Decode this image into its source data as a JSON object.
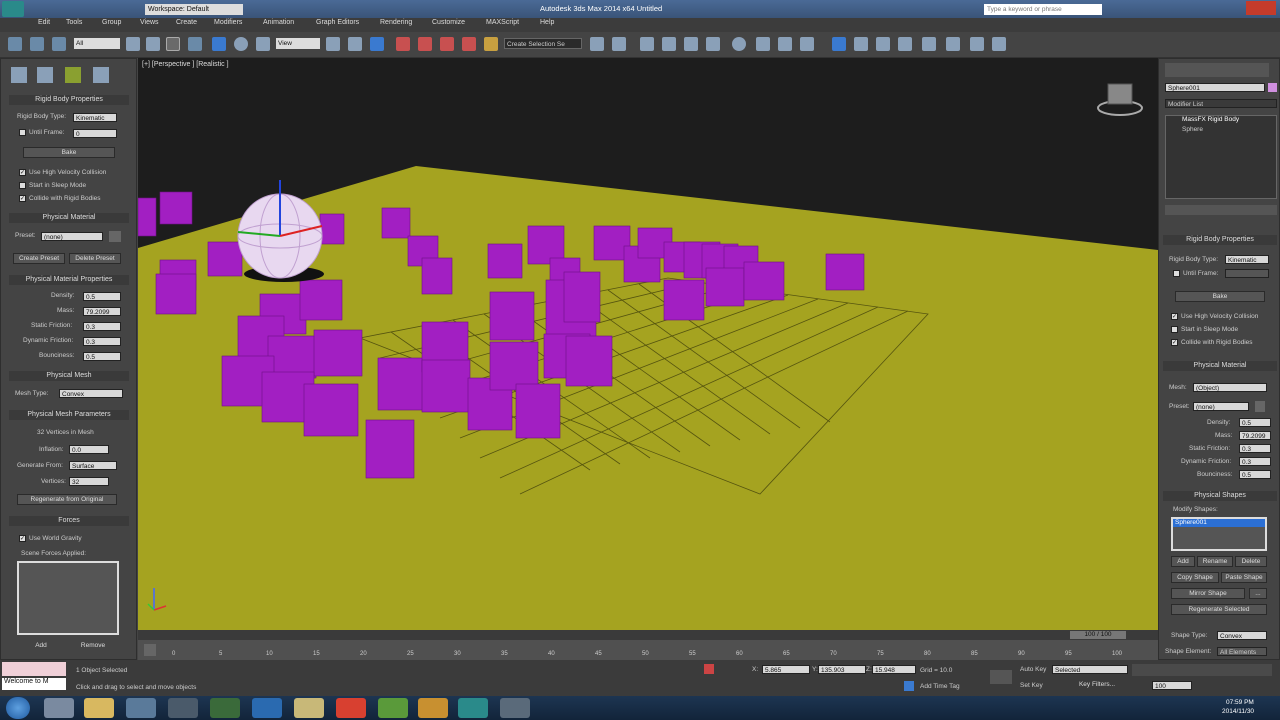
{
  "app": {
    "title": "Autodesk 3ds Max 2014 x64  Untitled",
    "workspace": "Workspace: Default",
    "search_placeholder": "Type a keyword or phrase"
  },
  "menu": [
    "Edit",
    "Tools",
    "Group",
    "Views",
    "Create",
    "Modifiers",
    "Animation",
    "Graph Editors",
    "Rendering",
    "Customize",
    "MAXScript",
    "Help"
  ],
  "toolbar": {
    "selection_filter": "All",
    "ref_coord": "View",
    "named_selection": "Create Selection Se"
  },
  "viewport": {
    "label": "[+] [Perspective ] [Realistic ]",
    "bg": "#1d1d1d",
    "ground": "#a5a320",
    "box_color": "#a21fc2"
  },
  "left_panel": {
    "rigid_body": {
      "title": "Rigid Body Properties",
      "type_label": "Rigid Body Type:",
      "type_value": "Kinematic",
      "until_frame_label": "Until Frame:",
      "until_frame_value": "0",
      "bake": "Bake",
      "high_velocity": "Use High Velocity Collision",
      "sleep": "Start in Sleep Mode",
      "collide": "Collide with Rigid Bodies"
    },
    "physical_material": {
      "title": "Physical Material",
      "preset_label": "Preset:",
      "preset_value": "(none)",
      "create": "Create Preset",
      "delete": "Delete Preset"
    },
    "pm_props": {
      "title": "Physical Material Properties",
      "density_label": "Density:",
      "density": "0.5",
      "mass_label": "Mass:",
      "mass": "79.2099",
      "static_label": "Static Friction:",
      "static": "0.3",
      "dynamic_label": "Dynamic Friction:",
      "dynamic": "0.3",
      "bounce_label": "Bounciness:",
      "bounce": "0.5"
    },
    "physical_mesh": {
      "title": "Physical Mesh",
      "type_label": "Mesh Type:",
      "type_value": "Convex"
    },
    "pm_params": {
      "title": "Physical Mesh Parameters",
      "verts_in_mesh": "32 Vertices in Mesh",
      "inflation_label": "Inflation:",
      "inflation": "0.0",
      "gen_label": "Generate From:",
      "gen": "Surface",
      "vertices_label": "Vertices:",
      "vertices": "32",
      "regen": "Regenerate from Original"
    },
    "forces": {
      "title": "Forces",
      "gravity": "Use World Gravity",
      "applied": "Scene Forces Applied:",
      "add": "Add",
      "remove": "Remove"
    }
  },
  "right_panel": {
    "object_name": "Sphere001",
    "modifier_list": "Modifier List",
    "stack": [
      "MassFX Rigid Body",
      "Sphere"
    ],
    "rigid_body": {
      "title": "Rigid Body Properties",
      "type_label": "Rigid Body Type:",
      "type_value": "Kinematic",
      "until_frame_label": "Until Frame:",
      "bake": "Bake",
      "high_velocity": "Use High Velocity Collision",
      "sleep": "Start in Sleep Mode",
      "collide": "Collide with Rigid Bodies"
    },
    "physical_material": {
      "title": "Physical Material",
      "mesh_label": "Mesh:",
      "mesh_value": "(Object)",
      "preset_label": "Preset:",
      "preset_value": "(none)",
      "density_label": "Density:",
      "density": "0.5",
      "mass_label": "Mass:",
      "mass": "79.2099",
      "static_label": "Static Friction:",
      "static": "0.3",
      "dynamic_label": "Dynamic Friction:",
      "dynamic": "0.3",
      "bounce_label": "Bounciness:",
      "bounce": "0.5"
    },
    "physical_shapes": {
      "title": "Physical Shapes",
      "modify": "Modify Shapes:",
      "item": "Sphere001",
      "add": "Add",
      "rename": "Rename",
      "delete": "Delete",
      "copy": "Copy Shape",
      "paste": "Paste Shape",
      "mirror": "Mirror Shape",
      "regen": "Regenerate Selected",
      "shape_type_label": "Shape Type:",
      "shape_type": "Convex",
      "shape_element_label": "Shape Element:",
      "shape_element": "All Elements"
    }
  },
  "timeline": {
    "counter": "100 / 100",
    "ticks": [
      "0",
      "5",
      "10",
      "15",
      "20",
      "25",
      "30",
      "35",
      "40",
      "45",
      "50",
      "55",
      "60",
      "65",
      "70",
      "75",
      "80",
      "85",
      "90",
      "95",
      "100"
    ]
  },
  "status": {
    "welcome": "Welcome to M",
    "selected": "1 Object Selected",
    "hint": "Click and drag to select and move objects",
    "x_label": "X:",
    "x": "5.865",
    "y_label": "Y:",
    "y": "135.903",
    "z_label": "Z:",
    "z": "15.948",
    "grid": "Grid = 10.0",
    "add_time_tag": "Add Time Tag",
    "auto_key": "Auto Key",
    "auto_key_value": "Selected",
    "set_key": "Set Key",
    "key_filters": "Key Filters...",
    "frame": "100"
  },
  "taskbar": {
    "time": "07:59 PM",
    "date": "2014/11/30"
  }
}
